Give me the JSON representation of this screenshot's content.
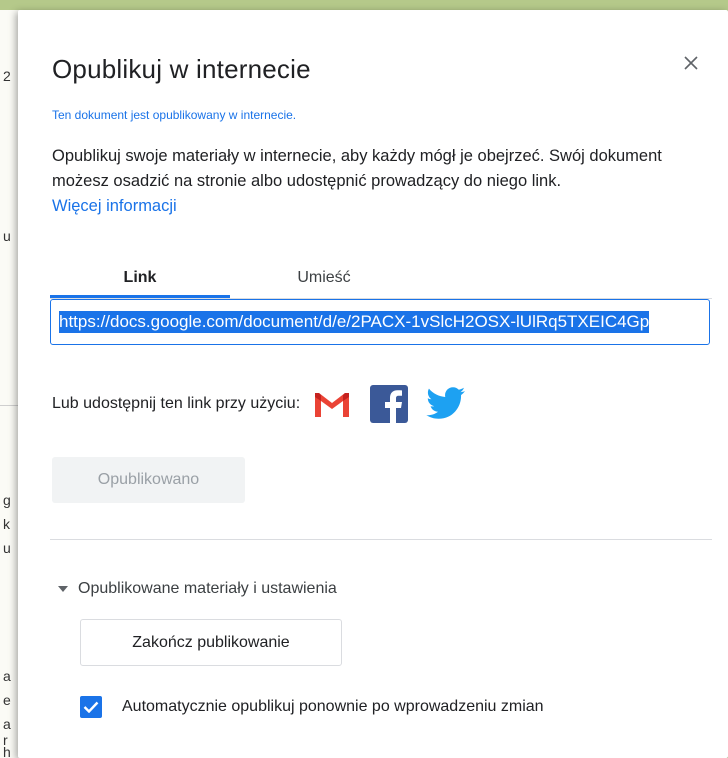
{
  "background": {
    "fragments": [
      "2",
      "u",
      "g",
      "k",
      "u",
      "a",
      "e",
      "a",
      "r",
      "h",
      ")"
    ]
  },
  "dialog": {
    "title": "Opublikuj w internecie",
    "close_label": "×",
    "status": "Ten dokument jest opublikowany w internecie.",
    "description": "Opublikuj swoje materiały w internecie, aby każdy mógł je obejrzeć. Swój dokument możesz osadzić na stronie albo udostępnić prowadzący do niego link.",
    "more_info_link": "Więcej informacji",
    "tabs": [
      {
        "label": "Link",
        "active": true
      },
      {
        "label": "Umieść",
        "active": false
      }
    ],
    "url_value": "https://docs.google.com/document/d/e/2PACX-1vSlcH2OSX-lUlRq5TXEIC4Gp",
    "share": {
      "label": "Lub udostępnij ten link przy użyciu:",
      "icons": [
        "gmail-icon",
        "facebook-icon",
        "twitter-icon"
      ]
    },
    "published_button": "Opublikowano",
    "section_header": "Opublikowane materiały i ustawienia",
    "stop_button": "Zakończ publikowanie",
    "auto_republish": {
      "label": "Automatycznie opublikuj ponownie po wprowadzeniu zmian",
      "checked": true
    }
  },
  "colors": {
    "accent": "#1a73e8",
    "backdrop": "#b5c98a",
    "gmail_red": "#ea4335",
    "facebook_blue": "#3b5998",
    "twitter_blue": "#1da1f2"
  }
}
